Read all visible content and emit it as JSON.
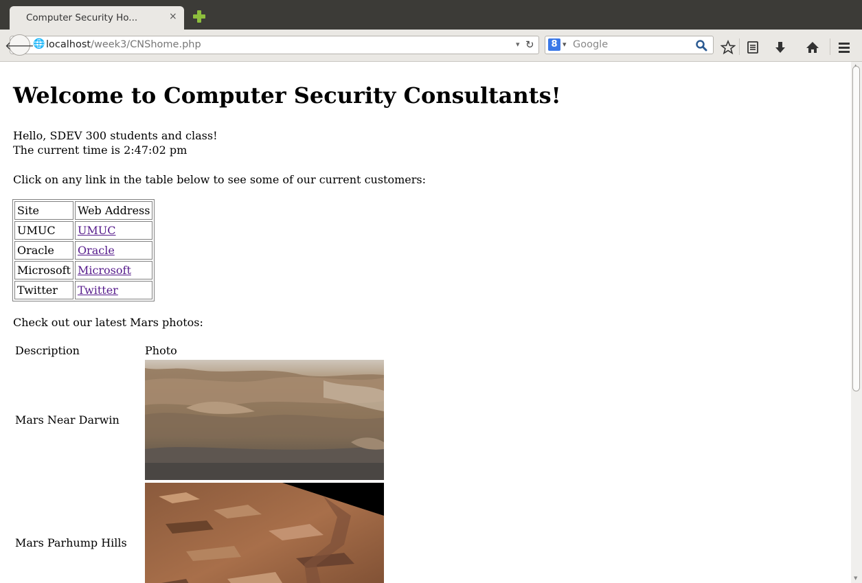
{
  "browser": {
    "tab_title": "Computer Security Ho...",
    "tab_close": "×",
    "url_host": "localhost",
    "url_path": "/week3/CNShome.php",
    "search_placeholder": "Google",
    "search_engine_badge": "8"
  },
  "page": {
    "heading": "Welcome to Computer Security Consultants!",
    "greeting": "Hello, SDEV 300 students and class!",
    "time_line": "The current time is 2:47:02 pm",
    "table_intro": "Click on any link in the table below to see some of our current customers:",
    "sites_table": {
      "headers": [
        "Site",
        "Web Address"
      ],
      "rows": [
        {
          "site": "UMUC",
          "link": "UMUC"
        },
        {
          "site": "Oracle",
          "link": "Oracle"
        },
        {
          "site": "Microsoft",
          "link": "Microsoft"
        },
        {
          "site": "Twitter",
          "link": "Twitter"
        }
      ]
    },
    "photos_intro": "Check out our latest Mars photos:",
    "photos_table": {
      "headers": [
        "Description",
        "Photo"
      ],
      "rows": [
        {
          "description": "Mars Near Darwin"
        },
        {
          "description": "Mars Parhump Hills"
        }
      ]
    }
  },
  "colors": {
    "visited_link": "#551a8b",
    "titlebar": "#3c3b37",
    "toolbar": "#eae8e4"
  }
}
